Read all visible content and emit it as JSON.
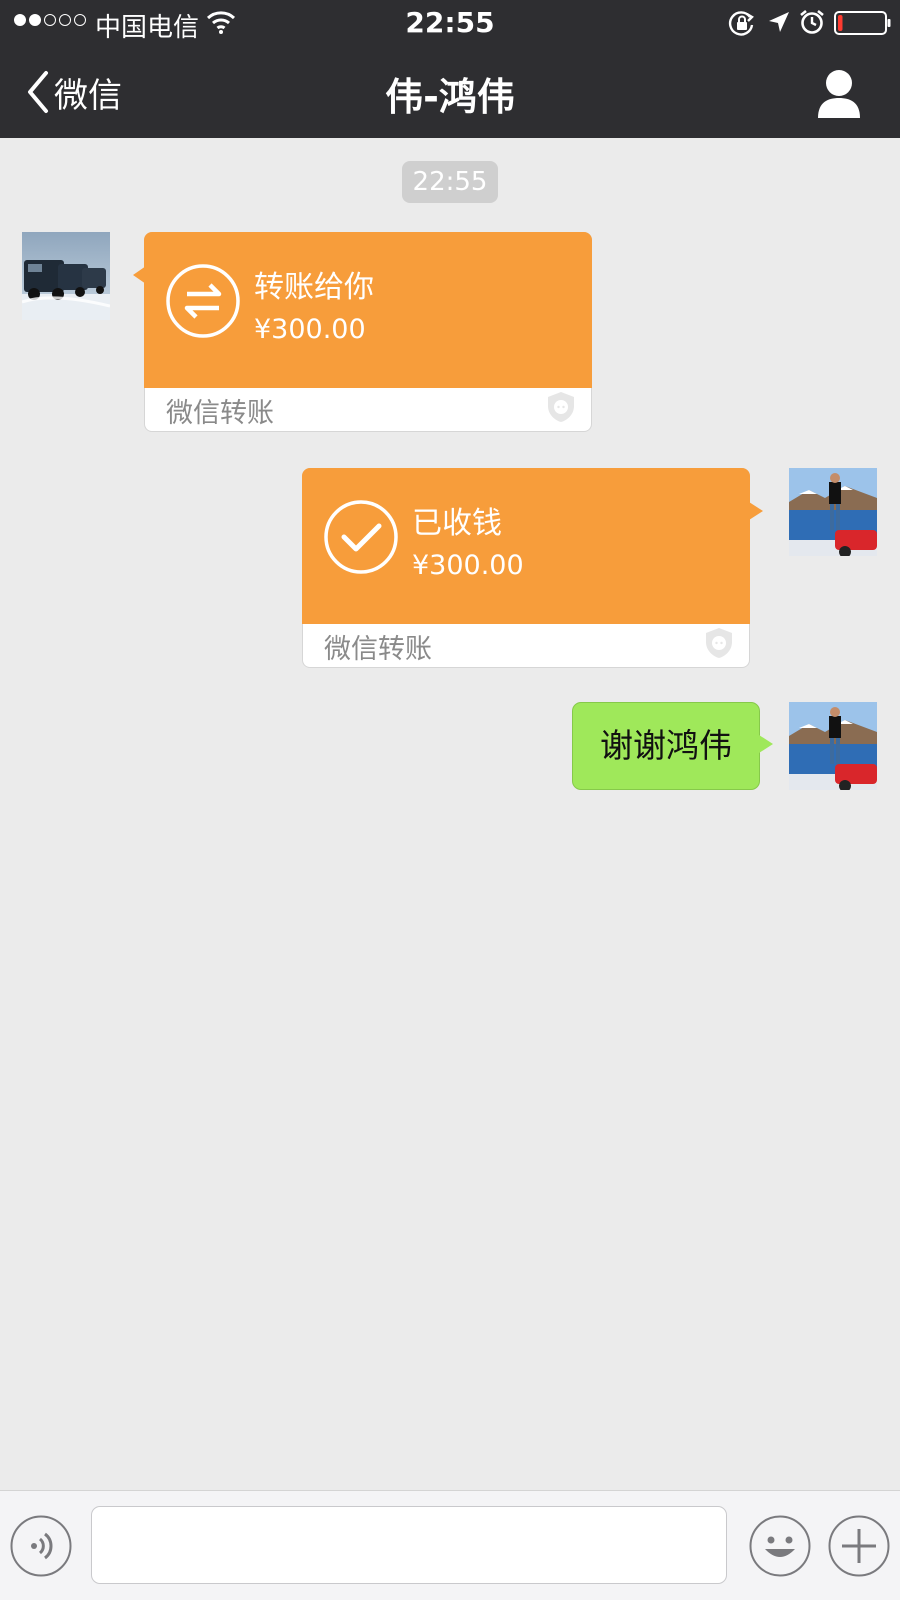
{
  "status_bar": {
    "carrier": "中国电信",
    "time": "22:55",
    "signal_bars_filled": 2,
    "signal_bars_total": 5,
    "battery_level": 0.1,
    "icons": [
      "wifi-icon",
      "rotation-lock-icon",
      "location-arrow-icon",
      "alarm-icon",
      "battery-icon"
    ]
  },
  "nav": {
    "back_label": "微信",
    "title": "伟-鸿伟",
    "right_icon": "person-icon"
  },
  "chat": {
    "timestamp": "22:55",
    "messages": [
      {
        "side": "left",
        "type": "transfer",
        "icon": "transfer-arrows-icon",
        "title": "转账给你",
        "amount": "¥300.00",
        "footer": "微信转账"
      },
      {
        "side": "right",
        "type": "transfer",
        "icon": "check-icon",
        "title": "已收钱",
        "amount": "¥300.00",
        "footer": "微信转账"
      },
      {
        "side": "right",
        "type": "text",
        "text": "谢谢鸿伟"
      }
    ]
  },
  "input_bar": {
    "voice_icon": "voice-icon",
    "input_value": "",
    "emoji_icon": "emoji-icon",
    "plus_icon": "plus-icon"
  },
  "colors": {
    "nav_bg": "#2e2e31",
    "transfer_orange": "#f79d3b",
    "outgoing_green": "#9fe85a",
    "chat_bg": "#ebebeb"
  }
}
